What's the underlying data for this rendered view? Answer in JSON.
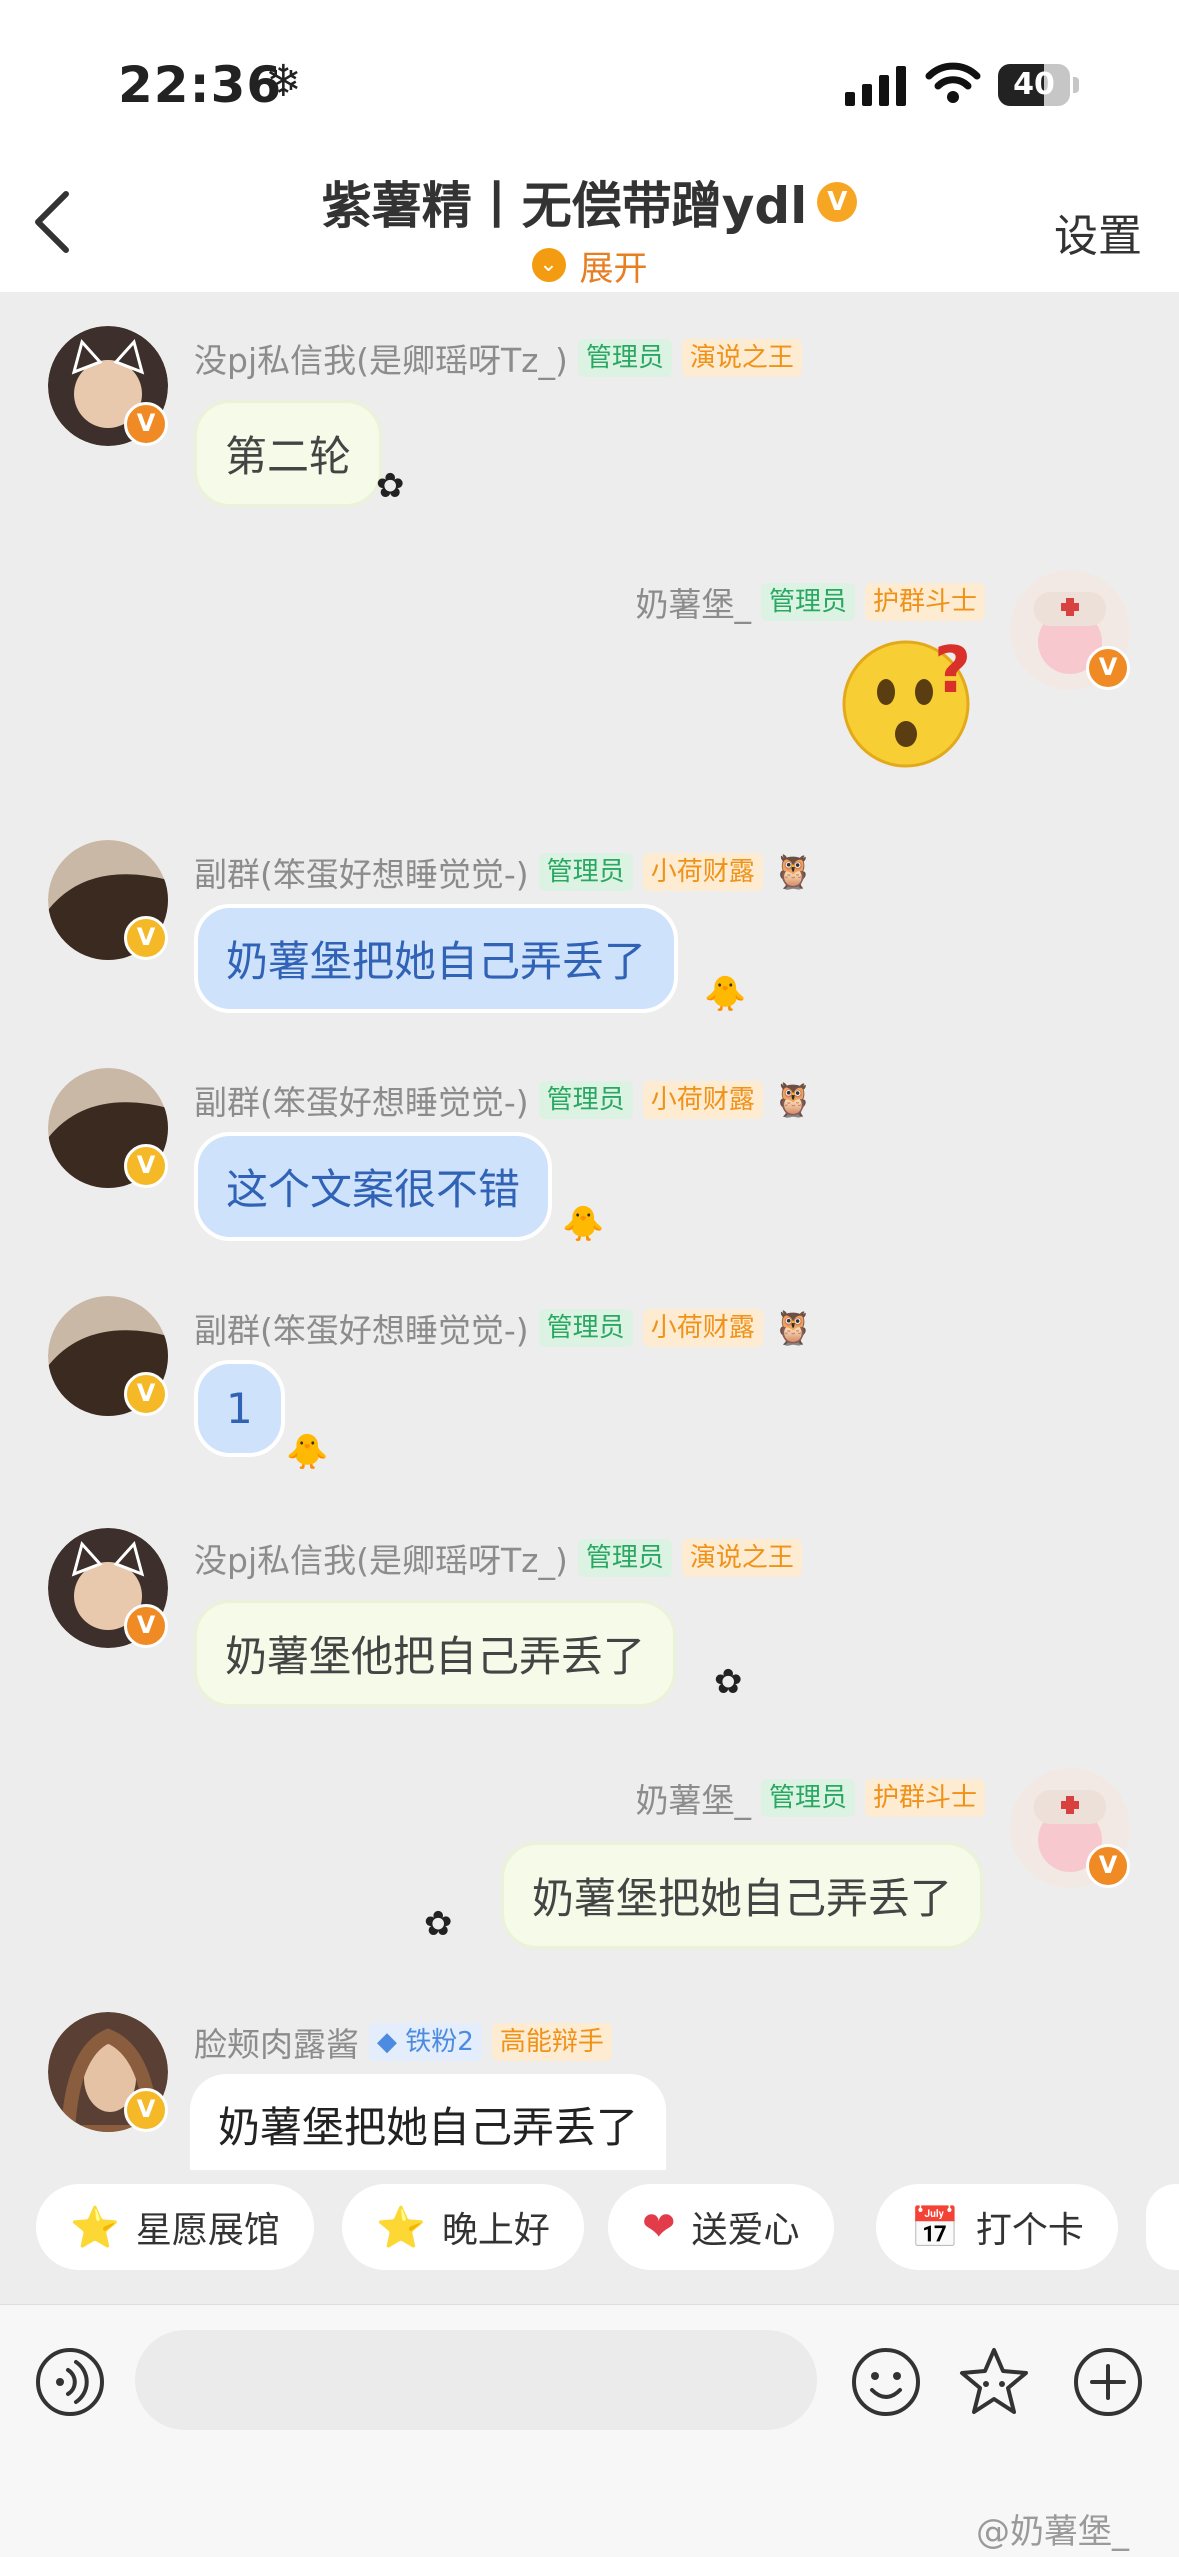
{
  "status_bar": {
    "time": "22:36",
    "weather_glyph": "❄",
    "battery": "40"
  },
  "header": {
    "back_icon": "chevron-left-icon",
    "title": "紫薯精丨无偿带蹭ydl",
    "badge": "V",
    "expand_label": "展开",
    "settings_label": "设置"
  },
  "messages": [
    {
      "sender": "没pj私信我(是卿瑶呀Tz_)",
      "tags": [
        "管理员",
        "演说之王"
      ],
      "text": "第二轮"
    },
    {
      "sender": "奶薯堡_",
      "tags": [
        "管理员",
        "护群斗士"
      ],
      "sticker": "😮❓"
    },
    {
      "sender": "副群(笨蛋好想睡觉觉-)",
      "tags": [
        "管理员",
        "小荷财露"
      ],
      "text": "奶薯堡把她自己弄丢了"
    },
    {
      "sender": "副群(笨蛋好想睡觉觉-)",
      "tags": [
        "管理员",
        "小荷财露"
      ],
      "text": "这个文案很不错"
    },
    {
      "sender": "副群(笨蛋好想睡觉觉-)",
      "tags": [
        "管理员",
        "小荷财露"
      ],
      "text": "1"
    },
    {
      "sender": "没pj私信我(是卿瑶呀Tz_)",
      "tags": [
        "管理员",
        "演说之王"
      ],
      "text": "奶薯堡他把自己弄丢了"
    },
    {
      "sender": "奶薯堡_",
      "tags": [
        "管理员",
        "护群斗士"
      ],
      "text": "奶薯堡把她自己弄丢了"
    },
    {
      "sender": "脸颊肉露酱",
      "tags": [
        "铁粉2",
        "高能辩手"
      ],
      "text": "奶薯堡把她自己弄丢了"
    }
  ],
  "badge_v": "V",
  "quick_replies": [
    {
      "icon": "⭐",
      "label": "星愿展馆"
    },
    {
      "icon": "⭐",
      "label": "晚上好"
    },
    {
      "icon": "❤",
      "label": "送爱心"
    },
    {
      "icon": "📅",
      "label": "打个卡"
    }
  ],
  "input": {
    "placeholder": ""
  },
  "watermark": "@奶薯堡_",
  "colors": {
    "accent_orange": "#f39c12",
    "admin_green": "#28a861",
    "blue_bubble": "#cfe2fb"
  }
}
